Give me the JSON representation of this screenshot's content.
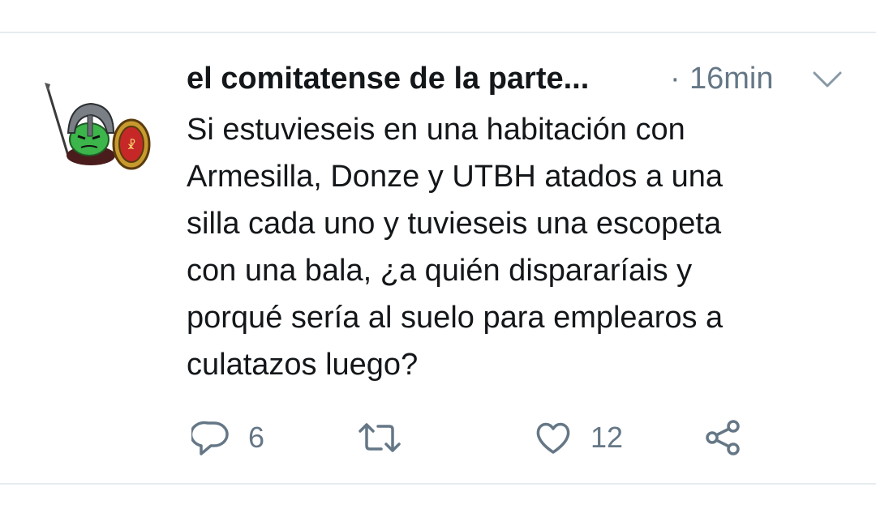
{
  "tweet": {
    "author_name": "el comitatense de la parte...",
    "separator": "·",
    "timestamp": "16min",
    "text": "Si estuvieseis en una habitación con\nArmesilla, Donze y UTBH atados a una\nsilla cada uno y tuvieseis una escopeta\ncon una bala, ¿a quién dispararíais y\nporqué sería al suelo para emplearos a\nculatazos luego?",
    "reply_count": "6",
    "retweet_count": "",
    "like_count": "12"
  },
  "icons": {
    "menu": "chevron-down-icon",
    "reply": "reply-icon",
    "retweet": "retweet-icon",
    "like": "heart-icon",
    "share": "share-icon"
  },
  "colors": {
    "text": "#14171a",
    "secondary": "#657786",
    "divider": "#e6ecf0"
  }
}
